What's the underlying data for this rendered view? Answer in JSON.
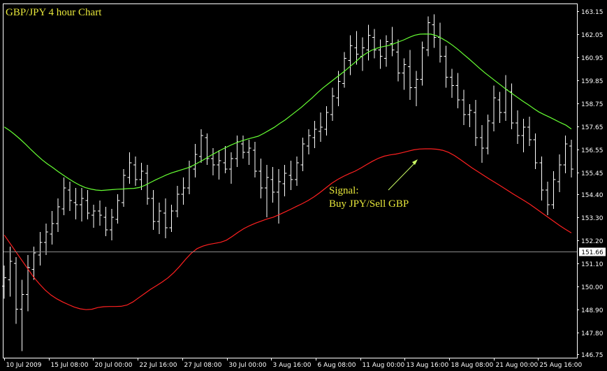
{
  "chart_data": {
    "type": "ohlc-line",
    "title": "GBP/JPY 4 hour Chart",
    "annotation": {
      "line1": "Signal:",
      "line2": "Buy JPY/Sell GBP"
    },
    "current_price": "151.66",
    "ylim": [
      146.75,
      163.15
    ],
    "y_ticks": [
      "163.15",
      "162.05",
      "160.95",
      "159.85",
      "158.75",
      "157.65",
      "156.55",
      "155.45",
      "154.40",
      "153.30",
      "152.20",
      "151.10",
      "150.00",
      "148.90",
      "147.80",
      "146.75"
    ],
    "x_ticks": [
      "10 Jul 2009",
      "15 Jul 08:00",
      "20 Jul 00:00",
      "22 Jul 16:00",
      "27 Jul 08:00",
      "30 Jul 00:00",
      "3 Aug 16:00",
      "6 Aug 08:00",
      "11 Aug 00:00",
      "13 Aug 16:00",
      "18 Aug 08:00",
      "21 Aug 00:00",
      "25 Aug 16:00"
    ],
    "colors": {
      "background": "#000000",
      "bars": "#ffffff",
      "ma_fast": "#66ff33",
      "ma_slow": "#ff2020",
      "text": "#e6e63a",
      "arrow": "#ccff66"
    },
    "series": [
      {
        "color_key": "ma_fast",
        "values": [
          157.62,
          157.45,
          157.24,
          157.02,
          156.78,
          156.52,
          156.28,
          156.05,
          155.85,
          155.67,
          155.48,
          155.3,
          155.13,
          154.97,
          154.83,
          154.72,
          154.65,
          154.6,
          154.58,
          154.6,
          154.62,
          154.64,
          154.65,
          154.67,
          154.68,
          154.72,
          154.82,
          154.95,
          155.08,
          155.2,
          155.32,
          155.42,
          155.5,
          155.58,
          155.66,
          155.78,
          155.92,
          156.06,
          156.22,
          156.36,
          156.5,
          156.63,
          156.75,
          156.86,
          156.95,
          157.03,
          157.1,
          157.17,
          157.3,
          157.45,
          157.6,
          157.78,
          157.95,
          158.15,
          158.35,
          158.55,
          158.78,
          159.0,
          159.25,
          159.48,
          159.68,
          159.88,
          160.08,
          160.28,
          160.5,
          160.72,
          160.95,
          161.13,
          161.28,
          161.38,
          161.45,
          161.5,
          161.58,
          161.68,
          161.78,
          161.9,
          162.0,
          162.05,
          162.06,
          162.05,
          161.98,
          161.85,
          161.7,
          161.52,
          161.32,
          161.1,
          160.88,
          160.65,
          160.42,
          160.2,
          160.0,
          159.8,
          159.6,
          159.4,
          159.22,
          159.03,
          158.85,
          158.68,
          158.5,
          158.33,
          158.2,
          158.08,
          157.95,
          157.82,
          157.7,
          157.52
        ]
      },
      {
        "color_key": "ma_slow",
        "values": [
          152.45,
          152.05,
          151.65,
          151.25,
          150.85,
          150.45,
          150.12,
          149.82,
          149.58,
          149.4,
          149.25,
          149.12,
          149.0,
          148.92,
          148.88,
          148.9,
          148.98,
          149.02,
          149.03,
          149.03,
          149.04,
          149.1,
          149.25,
          149.45,
          149.65,
          149.85,
          150.02,
          150.2,
          150.4,
          150.65,
          150.95,
          151.28,
          151.58,
          151.8,
          151.92,
          152.0,
          152.05,
          152.1,
          152.2,
          152.38,
          152.58,
          152.76,
          152.9,
          153.02,
          153.12,
          153.22,
          153.3,
          153.42,
          153.55,
          153.68,
          153.82,
          153.95,
          154.1,
          154.28,
          154.48,
          154.7,
          154.92,
          155.1,
          155.25,
          155.38,
          155.5,
          155.65,
          155.82,
          155.98,
          156.12,
          156.22,
          156.28,
          156.32,
          156.38,
          156.45,
          156.52,
          156.56,
          156.57,
          156.57,
          156.55,
          156.5,
          156.4,
          156.25,
          156.06,
          155.86,
          155.66,
          155.48,
          155.3,
          155.12,
          154.95,
          154.78,
          154.6,
          154.42,
          154.25,
          154.08,
          153.9,
          153.7,
          153.5,
          153.3,
          153.1,
          152.9,
          152.72,
          152.55
        ]
      }
    ],
    "bars": [
      [
        150.0,
        151.0,
        149.4,
        150.4
      ],
      [
        150.3,
        151.9,
        149.5,
        151.2
      ],
      [
        151.1,
        151.4,
        148.2,
        148.9
      ],
      [
        148.9,
        150.3,
        146.9,
        149.6
      ],
      [
        149.6,
        151.5,
        148.8,
        150.9
      ],
      [
        150.8,
        151.9,
        150.3,
        151.6
      ],
      [
        151.5,
        152.6,
        151.0,
        152.1
      ],
      [
        152.1,
        153.0,
        151.5,
        152.6
      ],
      [
        152.5,
        153.6,
        152.0,
        153.0
      ],
      [
        153.0,
        154.2,
        152.6,
        153.8
      ],
      [
        153.7,
        155.2,
        153.4,
        154.7
      ],
      [
        154.6,
        155.0,
        153.6,
        154.1
      ],
      [
        154.0,
        154.7,
        153.2,
        153.9
      ],
      [
        153.9,
        154.7,
        153.1,
        154.2
      ],
      [
        154.1,
        154.6,
        153.2,
        153.5
      ],
      [
        153.4,
        153.9,
        152.8,
        153.6
      ],
      [
        153.6,
        154.1,
        152.9,
        153.4
      ],
      [
        153.3,
        153.8,
        152.4,
        152.7
      ],
      [
        152.7,
        153.7,
        152.2,
        153.3
      ],
      [
        153.2,
        154.4,
        153.0,
        154.1
      ],
      [
        154.0,
        155.6,
        153.8,
        155.3
      ],
      [
        155.2,
        156.4,
        154.9,
        155.9
      ],
      [
        155.8,
        156.2,
        154.8,
        155.1
      ],
      [
        155.1,
        155.9,
        154.6,
        155.5
      ],
      [
        155.4,
        155.8,
        153.9,
        154.2
      ],
      [
        154.2,
        154.6,
        152.7,
        153.1
      ],
      [
        153.1,
        154.0,
        152.5,
        153.6
      ],
      [
        153.5,
        154.2,
        152.3,
        152.8
      ],
      [
        152.8,
        153.9,
        152.6,
        153.6
      ],
      [
        153.6,
        154.8,
        153.3,
        154.4
      ],
      [
        154.4,
        155.2,
        153.9,
        154.7
      ],
      [
        154.7,
        156.0,
        154.4,
        155.7
      ],
      [
        155.6,
        156.8,
        155.2,
        156.3
      ],
      [
        156.2,
        157.5,
        155.9,
        157.2
      ],
      [
        157.1,
        157.3,
        155.8,
        156.1
      ],
      [
        156.1,
        156.6,
        155.3,
        155.8
      ],
      [
        155.8,
        156.5,
        155.1,
        156.0
      ],
      [
        155.9,
        156.7,
        155.4,
        155.6
      ],
      [
        155.6,
        156.4,
        154.9,
        156.1
      ],
      [
        156.1,
        157.2,
        155.7,
        156.9
      ],
      [
        156.8,
        157.2,
        156.1,
        156.4
      ],
      [
        156.4,
        157.0,
        155.8,
        156.6
      ],
      [
        156.5,
        156.9,
        155.2,
        155.5
      ],
      [
        155.5,
        156.1,
        154.2,
        154.7
      ],
      [
        154.7,
        155.8,
        153.3,
        155.2
      ],
      [
        155.1,
        155.7,
        154.0,
        154.5
      ],
      [
        154.5,
        155.6,
        153.0,
        155.0
      ],
      [
        154.9,
        155.8,
        154.3,
        155.4
      ],
      [
        155.3,
        156.0,
        154.6,
        155.1
      ],
      [
        155.1,
        156.2,
        154.8,
        155.9
      ],
      [
        155.8,
        157.1,
        155.5,
        156.8
      ],
      [
        156.7,
        157.5,
        156.3,
        157.2
      ],
      [
        157.1,
        157.9,
        156.6,
        157.5
      ],
      [
        157.4,
        158.3,
        156.9,
        157.6
      ],
      [
        157.5,
        158.6,
        157.2,
        158.3
      ],
      [
        158.2,
        159.5,
        157.9,
        159.1
      ],
      [
        159.0,
        160.3,
        158.6,
        159.8
      ],
      [
        159.7,
        161.2,
        159.5,
        160.9
      ],
      [
        160.8,
        162.0,
        160.1,
        161.5
      ],
      [
        161.4,
        162.2,
        160.6,
        161.1
      ],
      [
        161.0,
        161.9,
        160.3,
        161.4
      ],
      [
        161.3,
        162.5,
        160.8,
        162.0
      ],
      [
        161.9,
        162.3,
        160.9,
        161.3
      ],
      [
        161.3,
        161.8,
        160.4,
        161.0
      ],
      [
        160.9,
        162.0,
        160.5,
        161.7
      ],
      [
        161.6,
        162.4,
        161.0,
        161.3
      ],
      [
        161.2,
        161.8,
        159.8,
        160.2
      ],
      [
        160.2,
        160.9,
        159.4,
        160.6
      ],
      [
        160.5,
        161.3,
        158.9,
        159.5
      ],
      [
        159.5,
        160.3,
        158.6,
        159.9
      ],
      [
        159.9,
        161.7,
        159.6,
        161.4
      ],
      [
        161.3,
        162.9,
        161.0,
        162.6
      ],
      [
        162.5,
        163.0,
        161.4,
        161.9
      ],
      [
        161.9,
        162.6,
        160.7,
        161.0
      ],
      [
        161.0,
        161.5,
        159.5,
        160.0
      ],
      [
        160.0,
        160.4,
        159.0,
        159.6
      ],
      [
        159.6,
        160.2,
        158.5,
        158.9
      ],
      [
        158.9,
        159.4,
        157.7,
        158.2
      ],
      [
        158.2,
        158.7,
        157.6,
        158.4
      ],
      [
        158.3,
        158.9,
        156.7,
        157.1
      ],
      [
        157.1,
        157.7,
        155.9,
        156.6
      ],
      [
        156.6,
        158.2,
        156.3,
        157.9
      ],
      [
        157.8,
        159.6,
        157.4,
        159.0
      ],
      [
        158.9,
        159.3,
        157.8,
        158.3
      ],
      [
        158.3,
        160.1,
        157.9,
        159.4
      ],
      [
        159.3,
        159.7,
        157.5,
        157.8
      ],
      [
        157.8,
        158.4,
        156.8,
        157.2
      ],
      [
        157.2,
        158.0,
        156.4,
        157.6
      ],
      [
        157.6,
        158.1,
        156.7,
        157.0
      ],
      [
        157.0,
        157.3,
        155.6,
        155.9
      ],
      [
        155.9,
        156.2,
        154.1,
        154.6
      ],
      [
        154.6,
        155.0,
        153.4,
        153.9
      ],
      [
        153.9,
        155.5,
        153.7,
        155.1
      ],
      [
        155.0,
        156.3,
        154.5,
        155.8
      ],
      [
        155.8,
        157.2,
        155.4,
        156.8
      ],
      [
        156.7,
        157.0,
        155.2,
        155.6
      ]
    ]
  }
}
